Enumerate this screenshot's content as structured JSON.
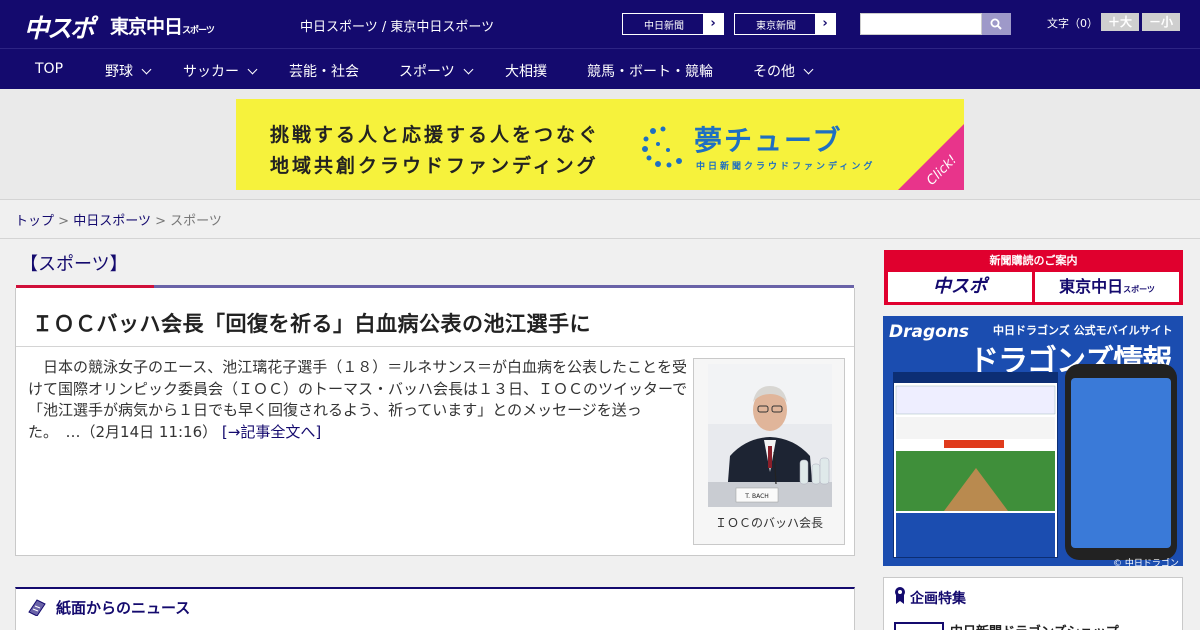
{
  "header": {
    "logo_primary": "中スポ",
    "logo_secondary": "東京中日",
    "logo_secondary_suffix": "スポーツ",
    "site_names": "中日スポーツ / 東京中日スポーツ",
    "site_buttons": [
      {
        "label": "中日新聞",
        "arrow": "›"
      },
      {
        "label": "東京新聞",
        "arrow": "›"
      }
    ],
    "search": {
      "placeholder": ""
    },
    "font_size_label": "文字（0）",
    "font_bigger": "＋大",
    "font_smaller": "－小"
  },
  "nav": {
    "items": [
      {
        "label": "TOP",
        "has_dropdown": false
      },
      {
        "label": "野球",
        "has_dropdown": true
      },
      {
        "label": "サッカー",
        "has_dropdown": true
      },
      {
        "label": "芸能・社会",
        "has_dropdown": false
      },
      {
        "label": "スポーツ",
        "has_dropdown": true
      },
      {
        "label": "大相撲",
        "has_dropdown": false
      },
      {
        "label": "競馬・ボート・競輪",
        "has_dropdown": false
      },
      {
        "label": "その他",
        "has_dropdown": true
      }
    ]
  },
  "banner": {
    "line1": "挑戦する人と応援する人をつなぐ",
    "line2": "地域共創クラウドファンディング",
    "brand": "夢チューブ",
    "brand_sub": "中日新聞クラウドファンディング",
    "click": "Click!",
    "colors": {
      "background": "#f6f23c",
      "brand": "#1e6fc2",
      "click": "#e8348b"
    }
  },
  "breadcrumb": {
    "items": [
      "トップ",
      "中日スポーツ",
      "スポーツ"
    ],
    "separator": ">"
  },
  "main": {
    "section_title": "【スポーツ】",
    "article": {
      "title": "ＩＯＣバッハ会長「回復を祈る」白血病公表の池江選手に",
      "body": "　日本の競泳女子のエース、池江璃花子選手（１８）＝ルネサンス＝が白血病を公表したことを受けて国際オリンピック委員会（ＩＯＣ）のトーマス・バッハ会長は１３日、ＩＯＣのツイッターで「池江選手が病気から１日でも早く回復されるよう、祈っています」とのメッセージを送った。　…（2月14日 11:16）",
      "more_link": "[→記事全文へ]",
      "photo_caption": "ＩＯＣのバッハ会長",
      "nameplate": "T. BACH"
    },
    "news_section_title": "紙面からのニュース"
  },
  "sidebar": {
    "subscription_header": "新聞購読のご案内",
    "subscription_buttons": [
      "中スポ",
      "東京中日"
    ],
    "subscription_suffix": "スポーツ",
    "dragons_ad": {
      "title": "Dragons",
      "subtitle": "中日ドラゴンズ 公式モバイルサイト",
      "headline": "ドラゴンズ情報",
      "copyright": "© 中日ドラゴンズ"
    },
    "kikaku_title": "企画特集",
    "kikaku_item": "中日新聞ドラゴンズショップ"
  },
  "colors": {
    "navy": "#140a6e",
    "accent_red": "#d0103a",
    "subscription_red": "#e0002e"
  }
}
